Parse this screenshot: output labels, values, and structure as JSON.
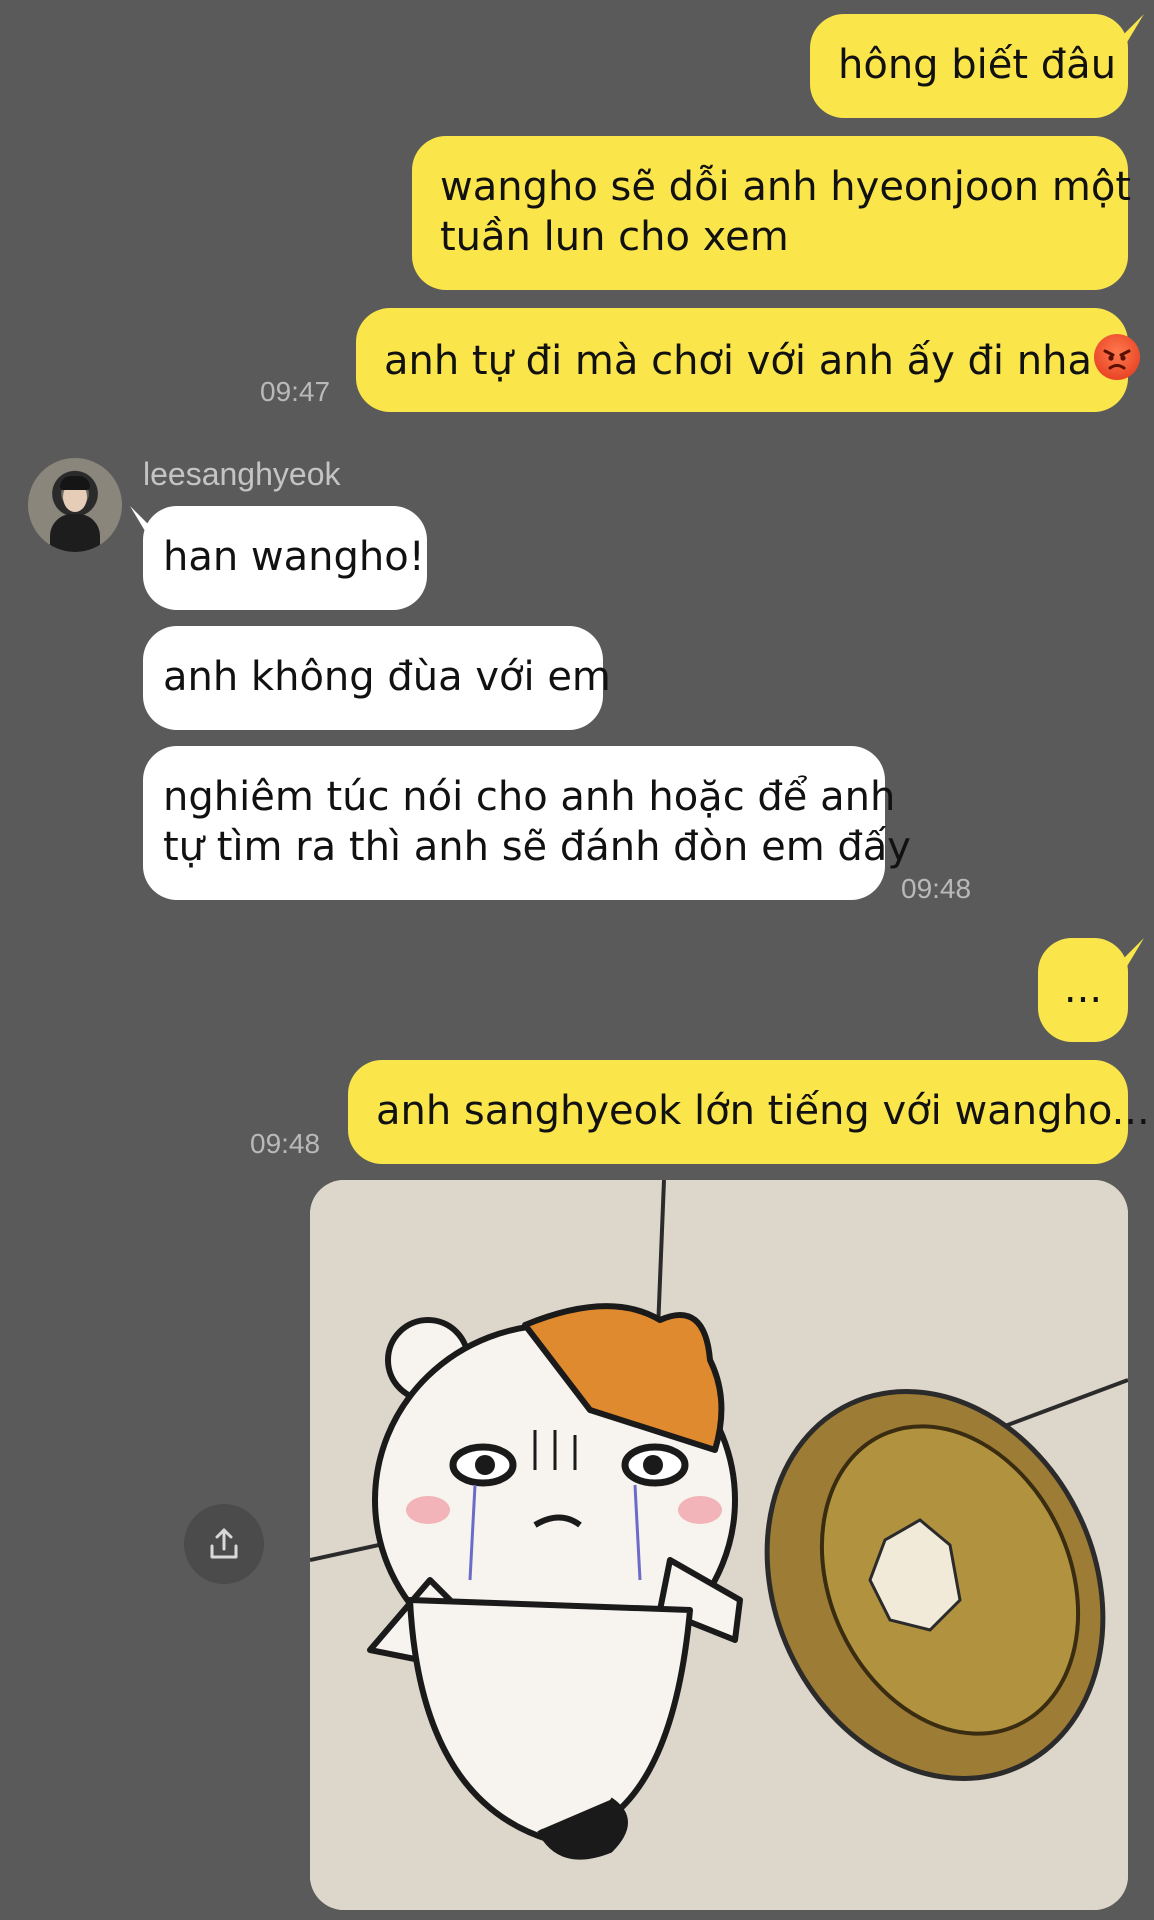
{
  "messages": {
    "m1": "hông biết đâu",
    "m2_line1": "wangho sẽ dỗi anh hyeonjoon một",
    "m2_line2": "tuần lun cho xem",
    "m3": "anh tự đi mà chơi với anh ấy đi nha",
    "t1": "09:47",
    "sender_name": "leesanghyeok",
    "r1": "han wangho!",
    "r2": "anh không đùa với em",
    "r3_line1": "nghiêm túc nói cho anh hoặc để anh",
    "r3_line2": "tự tìm ra thì anh sẽ đánh đòn em đấy",
    "t2": "09:48",
    "m4": "...",
    "m5": "anh sanghyeok lớn tiếng với wangho...",
    "t3": "09:48"
  },
  "icons": {
    "angry_emoji": "angry-face-emoji",
    "share": "share-icon",
    "sticker": "crying-hamster-sticker"
  },
  "colors": {
    "background": "#5a5a5a",
    "my_bubble": "#fae54b",
    "their_bubble": "#ffffff",
    "timestamp": "#b9b9b9"
  }
}
